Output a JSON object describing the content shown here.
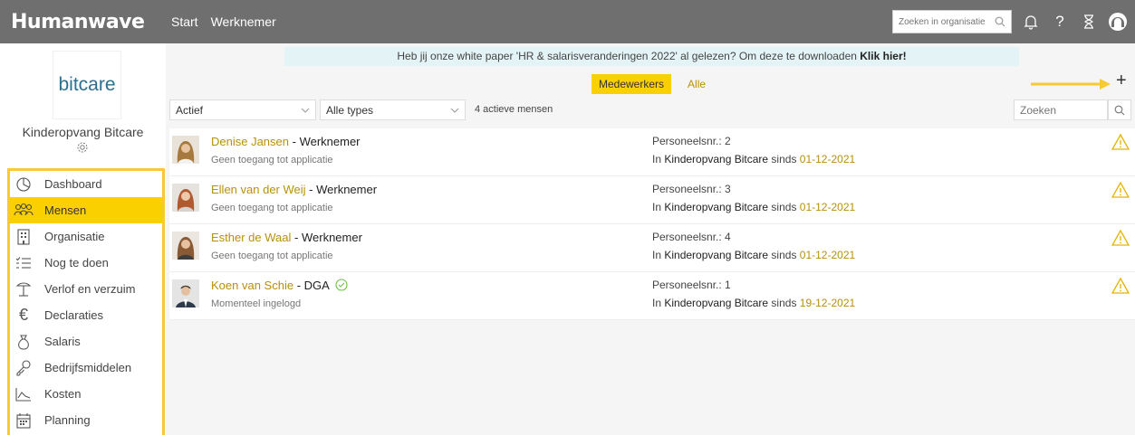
{
  "app": {
    "logo": "Humanwave",
    "nav": [
      "Start",
      "Werknemer"
    ],
    "search_placeholder": "Zoeken in organisatie",
    "icons": [
      "search-icon",
      "bell-icon",
      "help-icon",
      "hourglass-icon",
      "user-avatar-icon"
    ]
  },
  "sidebar": {
    "brand": "bitcare",
    "org_name": "Kinderopvang Bitcare",
    "menu": [
      {
        "label": "Dashboard",
        "icon": "dashboard-icon",
        "active": false
      },
      {
        "label": "Mensen",
        "icon": "people-icon",
        "active": true
      },
      {
        "label": "Organisatie",
        "icon": "building-icon",
        "active": false
      },
      {
        "label": "Nog te doen",
        "icon": "checklist-icon",
        "active": false
      },
      {
        "label": "Verlof en verzuim",
        "icon": "leave-icon",
        "active": false
      },
      {
        "label": "Declaraties",
        "icon": "euro-icon",
        "active": false
      },
      {
        "label": "Salaris",
        "icon": "money-bag-icon",
        "active": false
      },
      {
        "label": "Bedrijfsmiddelen",
        "icon": "key-icon",
        "active": false
      },
      {
        "label": "Kosten",
        "icon": "chart-icon",
        "active": false
      },
      {
        "label": "Planning",
        "icon": "calendar-icon",
        "active": false
      }
    ]
  },
  "banner": {
    "text": "Heb jij onze white paper 'HR & salarisveranderingen 2022' al gelezen? Om deze te downloaden ",
    "link": "Klik hier!"
  },
  "toggles": {
    "active": "Medewerkers",
    "other": "Alle"
  },
  "filters": {
    "status": "Actief",
    "type": "Alle types",
    "count": "4 actieve mensen",
    "search_placeholder": "Zoeken"
  },
  "people": [
    {
      "name": "Denise Jansen",
      "role": "Werknemer",
      "sub": "Geen toegang tot applicatie",
      "nr": "Personeelsnr.: 2",
      "in": "In ",
      "org": "Kinderopvang Bitcare",
      "since": " sinds ",
      "date": "01-12-2021",
      "verified": false
    },
    {
      "name": "Ellen van der Weij",
      "role": "Werknemer",
      "sub": "Geen toegang tot applicatie",
      "nr": "Personeelsnr.: 3",
      "in": "In ",
      "org": "Kinderopvang Bitcare",
      "since": " sinds ",
      "date": "01-12-2021",
      "verified": false
    },
    {
      "name": "Esther de Waal",
      "role": "Werknemer",
      "sub": "Geen toegang tot applicatie",
      "nr": "Personeelsnr.: 4",
      "in": "In ",
      "org": "Kinderopvang Bitcare",
      "since": " sinds ",
      "date": "01-12-2021",
      "verified": false
    },
    {
      "name": "Koen van Schie",
      "role": "DGA",
      "sub": "Momenteel ingelogd",
      "nr": "Personeelsnr.: 1",
      "in": "In ",
      "org": "Kinderopvang Bitcare",
      "since": " sinds ",
      "date": "19-12-2021",
      "verified": true
    }
  ],
  "colors": {
    "accent": "#fbd000",
    "link": "#b8900a",
    "topbar": "#6f6f6f",
    "highlight_border": "#f7c934"
  }
}
